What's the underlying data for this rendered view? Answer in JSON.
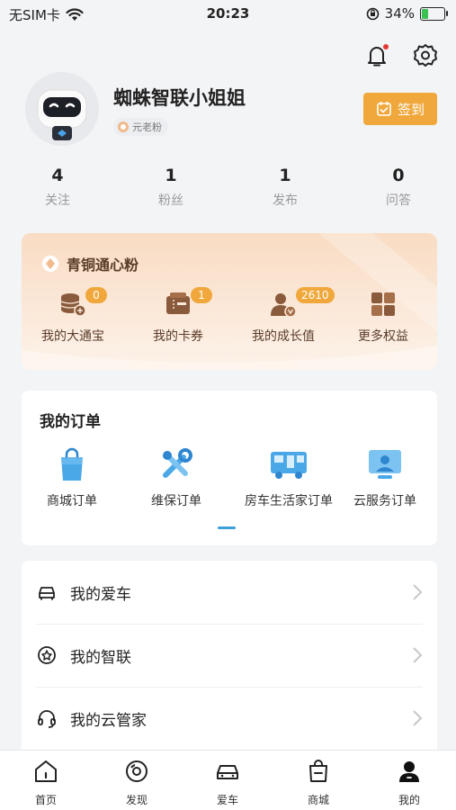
{
  "status_bar": {
    "carrier": "无SIM卡",
    "time": "20:23",
    "battery_percent": "34%",
    "battery_level": 0.34
  },
  "profile": {
    "username": "蜘蛛智联小姐姐",
    "fan_tag": "元老粉",
    "checkin_label": "签到"
  },
  "stats": [
    {
      "value": "4",
      "label": "关注"
    },
    {
      "value": "1",
      "label": "粉丝"
    },
    {
      "value": "1",
      "label": "发布"
    },
    {
      "value": "0",
      "label": "问答"
    }
  ],
  "vip": {
    "level_title": "青铜通心粉",
    "items": [
      {
        "label": "我的大通宝",
        "badge": "0",
        "icon": "coins-icon"
      },
      {
        "label": "我的卡券",
        "badge": "1",
        "icon": "coupon-icon"
      },
      {
        "label": "我的成长值",
        "badge": "2610",
        "icon": "growth-icon"
      },
      {
        "label": "更多权益",
        "badge": "",
        "icon": "grid-icon"
      }
    ]
  },
  "orders": {
    "title": "我的订单",
    "items": [
      {
        "label": "商城订单",
        "icon": "shopping-bag-icon"
      },
      {
        "label": "维保订单",
        "icon": "tools-icon"
      },
      {
        "label": "房车生活家订单",
        "icon": "rv-icon"
      },
      {
        "label": "云服务订单",
        "icon": "cloud-service-icon"
      }
    ]
  },
  "menu": [
    {
      "label": "我的爱车",
      "icon": "car-icon"
    },
    {
      "label": "我的智联",
      "icon": "smart-connect-icon"
    },
    {
      "label": "我的云管家",
      "icon": "headset-icon"
    }
  ],
  "bottom_nav": [
    {
      "label": "首页",
      "icon": "home-icon"
    },
    {
      "label": "发现",
      "icon": "discover-icon"
    },
    {
      "label": "爱车",
      "icon": "car-icon"
    },
    {
      "label": "商城",
      "icon": "mall-icon"
    },
    {
      "label": "我的",
      "icon": "profile-icon",
      "active": true
    }
  ],
  "colors": {
    "accent_orange": "#f0a73b",
    "vip_text": "#5a3c2a",
    "indicator_blue": "#3c9fd8"
  }
}
